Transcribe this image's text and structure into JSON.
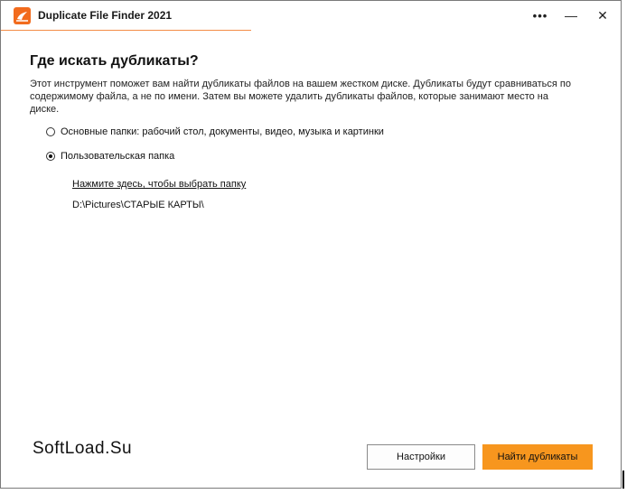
{
  "window": {
    "title": "Duplicate File Finder 2021",
    "controls": {
      "more": "•••",
      "minimize": "—",
      "close": "✕"
    }
  },
  "main": {
    "heading": "Где искать дубликаты?",
    "description": "Этот инструмент поможет вам найти дубликаты файлов на вашем жестком диске. Дубликаты будут сравниваться по содержимому файла, а не по имени. Затем вы можете удалить дубликаты файлов, которые занимают место на диске.",
    "options": [
      {
        "label": "Основные папки: рабочий стол, документы, видео, музыка и картинки",
        "selected": false
      },
      {
        "label": "Пользовательская папка",
        "selected": true
      }
    ],
    "choose_folder_link": "Нажмите здесь, чтобы выбрать папку",
    "selected_path": "D:\\Pictures\\СТАРЫЕ КАРТЫ\\"
  },
  "footer": {
    "watermark": "SoftLoad.Su",
    "settings_label": "Настройки",
    "find_label": "Найти дубликаты"
  },
  "colors": {
    "accent": "#f7961e",
    "icon": "#f26b1d",
    "title_underline": "#f48c46"
  },
  "icons": {
    "app": "duplicate-finder-app-icon",
    "more": "more-icon",
    "minimize": "minimize-icon",
    "close": "close-icon"
  }
}
